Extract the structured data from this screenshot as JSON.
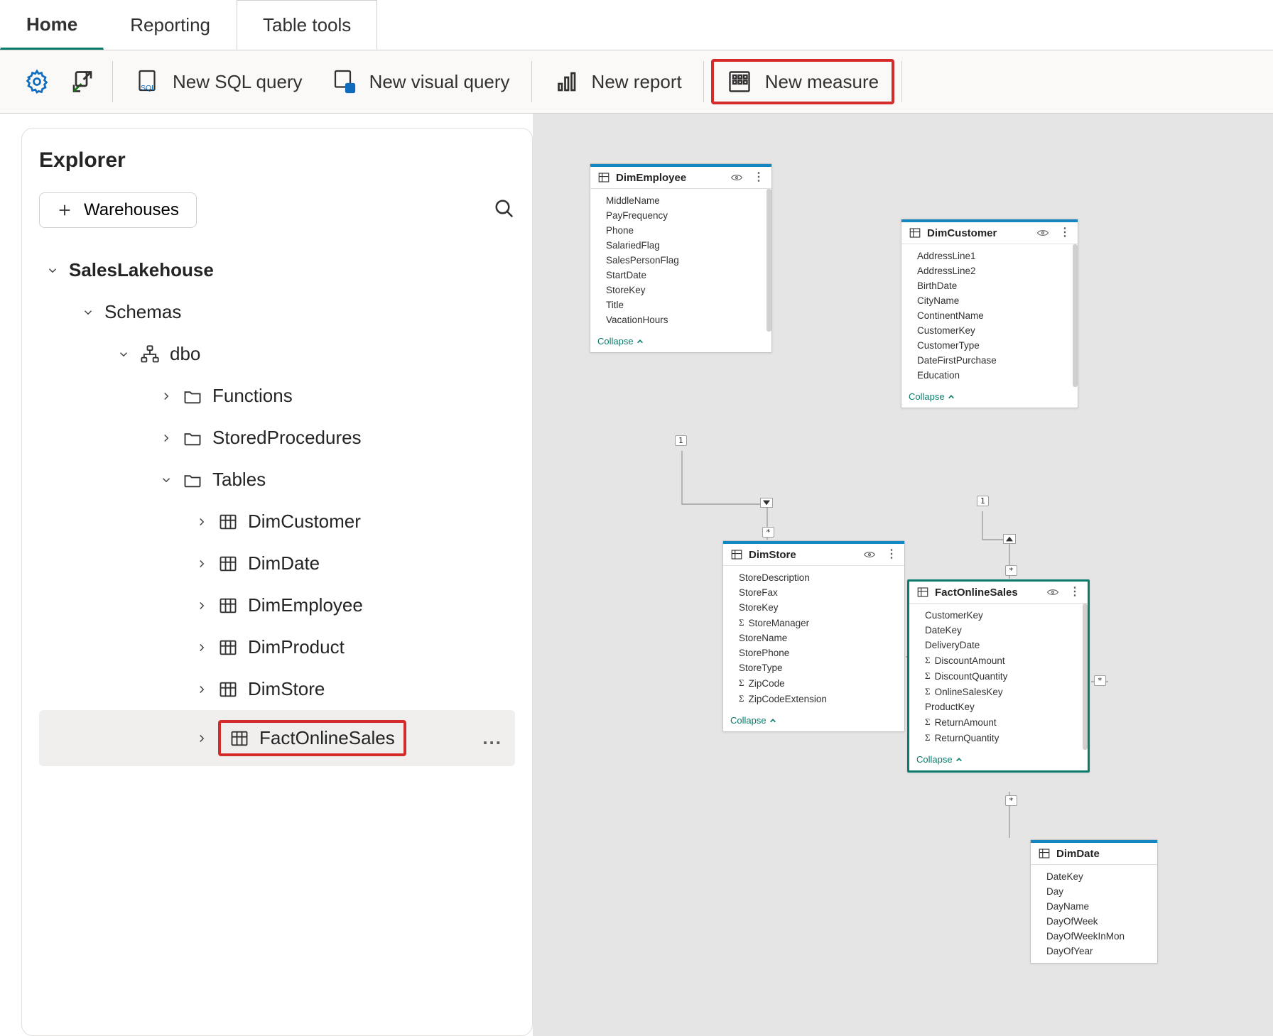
{
  "tabs": {
    "home": "Home",
    "reporting": "Reporting",
    "tableTools": "Table tools"
  },
  "toolbar": {
    "newSqlQuery": "New SQL query",
    "newVisualQuery": "New visual query",
    "newReport": "New report",
    "newMeasure": "New measure"
  },
  "explorer": {
    "title": "Explorer",
    "addWarehouses": "Warehouses",
    "root": "SalesLakehouse",
    "schemas": "Schemas",
    "dbo": "dbo",
    "functions": "Functions",
    "storedProcedures": "StoredProcedures",
    "tablesLabel": "Tables",
    "tables": [
      "DimCustomer",
      "DimDate",
      "DimEmployee",
      "DimProduct",
      "DimStore",
      "FactOnlineSales"
    ],
    "more": "..."
  },
  "cards": {
    "collapseLabel": "Collapse",
    "dimEmployee": {
      "title": "DimEmployee",
      "cols": [
        "MiddleName",
        "PayFrequency",
        "Phone",
        "SalariedFlag",
        "SalesPersonFlag",
        "StartDate",
        "StoreKey",
        "Title",
        "VacationHours"
      ]
    },
    "dimCustomer": {
      "title": "DimCustomer",
      "cols": [
        "AddressLine1",
        "AddressLine2",
        "BirthDate",
        "CityName",
        "ContinentName",
        "CustomerKey",
        "CustomerType",
        "DateFirstPurchase",
        "Education"
      ]
    },
    "dimStore": {
      "title": "DimStore",
      "cols": [
        {
          "n": "StoreDescription"
        },
        {
          "n": "StoreFax"
        },
        {
          "n": "StoreKey"
        },
        {
          "n": "StoreManager",
          "sigma": true
        },
        {
          "n": "StoreName"
        },
        {
          "n": "StorePhone"
        },
        {
          "n": "StoreType"
        },
        {
          "n": "ZipCode",
          "sigma": true
        },
        {
          "n": "ZipCodeExtension",
          "sigma": true
        }
      ]
    },
    "factOnlineSales": {
      "title": "FactOnlineSales",
      "cols": [
        {
          "n": "CustomerKey"
        },
        {
          "n": "DateKey"
        },
        {
          "n": "DeliveryDate"
        },
        {
          "n": "DiscountAmount",
          "sigma": true
        },
        {
          "n": "DiscountQuantity",
          "sigma": true
        },
        {
          "n": "OnlineSalesKey",
          "sigma": true
        },
        {
          "n": "ProductKey"
        },
        {
          "n": "ReturnAmount",
          "sigma": true
        },
        {
          "n": "ReturnQuantity",
          "sigma": true
        }
      ]
    },
    "dimDate": {
      "title": "DimDate",
      "cols": [
        "DateKey",
        "Day",
        "DayName",
        "DayOfWeek",
        "DayOfWeekInMon",
        "DayOfYear"
      ]
    }
  },
  "rel": {
    "one": "1",
    "many": "*"
  }
}
